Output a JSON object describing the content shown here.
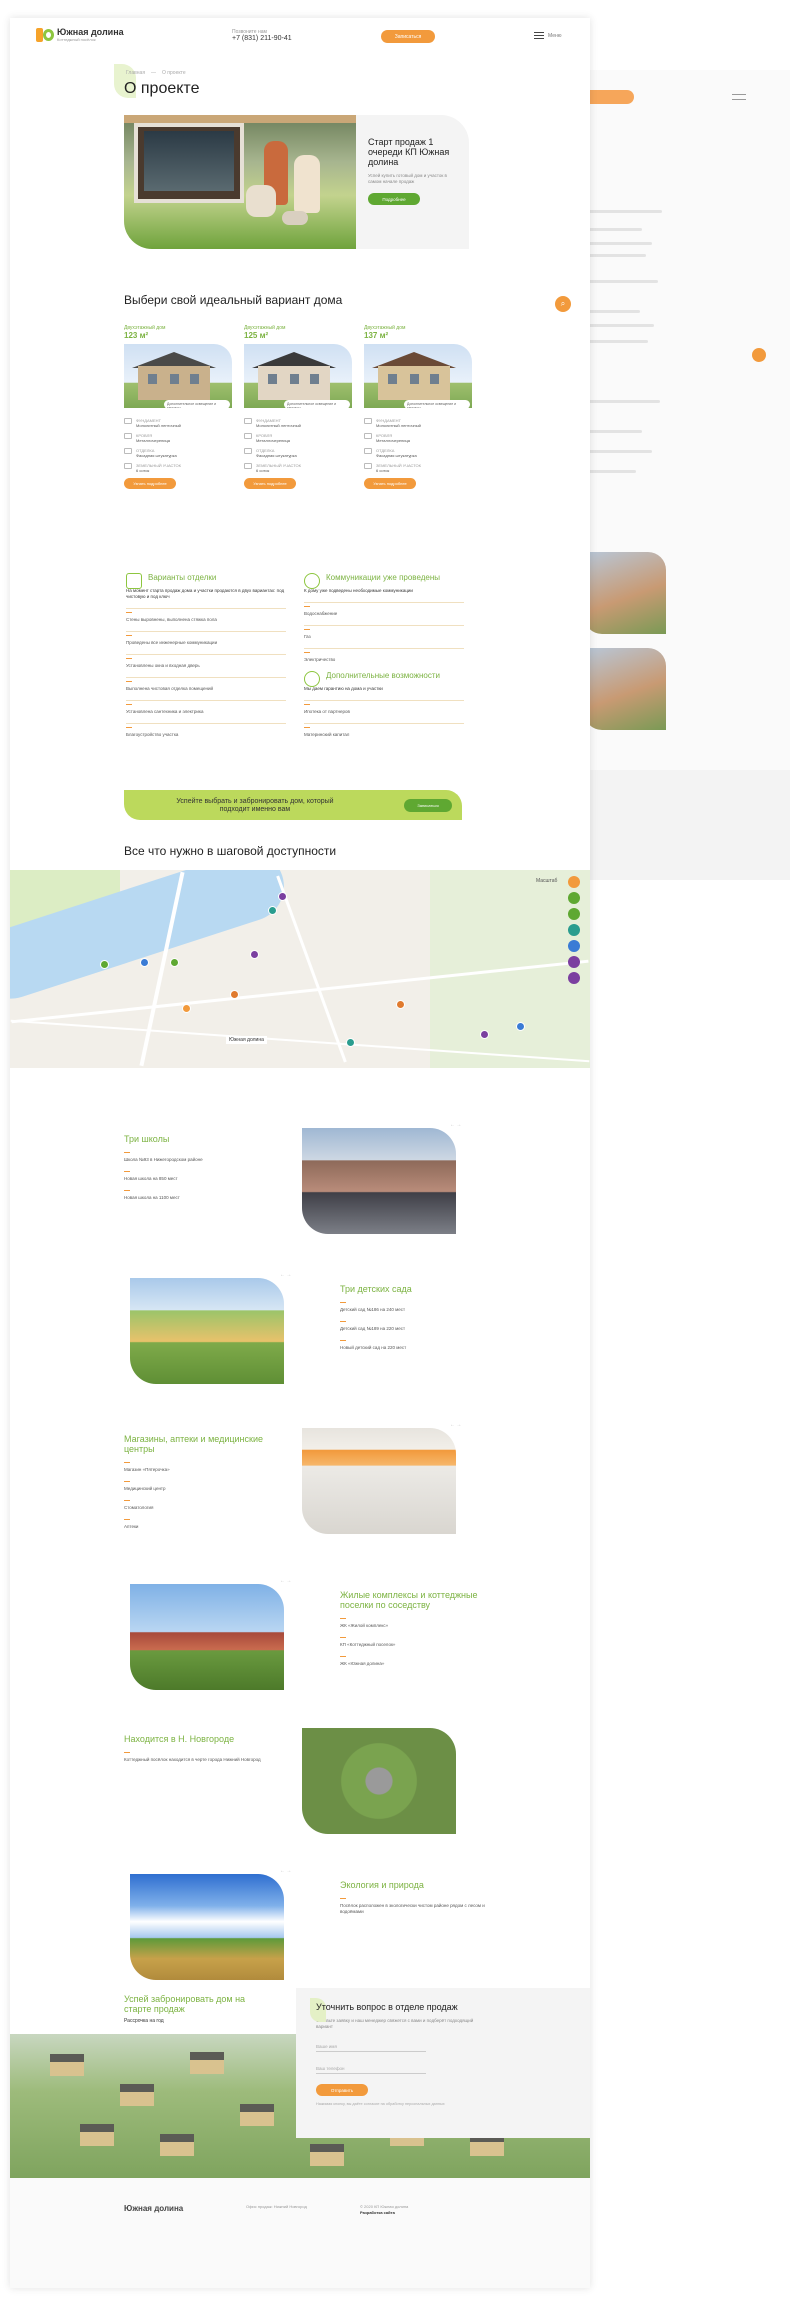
{
  "header": {
    "logo_text": "Южная долина",
    "logo_sub": "Коттеджный посёлок",
    "phone_caption": "Позвоните нам",
    "phone": "+7 (831) 211-90-41",
    "callback_label": "Записаться",
    "menu_label": "Меню"
  },
  "breadcrumbs": [
    "Главная",
    "О проекте"
  ],
  "page_title": "О проекте",
  "hero": {
    "title": "Старт продаж 1 очереди КП Южная долина",
    "text": "Успей купить готовый дом и участок в самом начале продаж",
    "button": "Подробнее"
  },
  "choose": {
    "title": "Выбери свой идеальный вариант дома",
    "houses": [
      {
        "name": "Двухэтажный дом",
        "area": "123 м²",
        "tag": "Дополнительное освещение и террасы",
        "specs": [
          [
            "ФУНДАМЕНТ",
            "Монолитный ленточный"
          ],
          [
            "КРОВЛЯ",
            "Металлочерепица"
          ],
          [
            "ОТДЕЛКА",
            "Фасадная штукатурка"
          ],
          [
            "ЗЕМЕЛЬНЫЙ УЧАСТОК",
            "6 соток"
          ]
        ],
        "button": "Узнать подробнее"
      },
      {
        "name": "Двухэтажный дом",
        "area": "125 м²",
        "tag": "Дополнительное освещение и террасы",
        "specs": [
          [
            "ФУНДАМЕНТ",
            "Монолитный ленточный"
          ],
          [
            "КРОВЛЯ",
            "Металлочерепица"
          ],
          [
            "ОТДЕЛКА",
            "Фасадная штукатурка"
          ],
          [
            "ЗЕМЕЛЬНЫЙ УЧАСТОК",
            "6 соток"
          ]
        ],
        "button": "Узнать подробнее"
      },
      {
        "name": "Двухэтажный дом",
        "area": "137 м²",
        "tag": "Дополнительное освещение и террасы",
        "specs": [
          [
            "ФУНДАМЕНТ",
            "Монолитный ленточный"
          ],
          [
            "КРОВЛЯ",
            "Металлочерепица"
          ],
          [
            "ОТДЕЛКА",
            "Фасадная штукатурка"
          ],
          [
            "ЗЕМЕЛЬНЫЙ УЧАСТОК",
            "6 соток"
          ]
        ],
        "button": "Узнать подробнее"
      }
    ]
  },
  "features": {
    "finish": {
      "title": "Варианты отделки",
      "lead": "На момент старта продаж дома и участки продаются в двух вариантах: под чистовую и под ключ",
      "items": [
        "Стены выровнены, выполнена стяжка пола",
        "Проведены все инженерные коммуникации",
        "Установлены окна и входная дверь",
        "Выполнена чистовая отделка помещений",
        "Установлена сантехника и электрика",
        "Благоустройство участка"
      ]
    },
    "utilities": {
      "title": "Коммуникации уже проведены",
      "lead": "К дому уже подведены необходимые коммуникации",
      "items": [
        "Водоснабжение",
        "Газ",
        "Электричество"
      ]
    },
    "extra": {
      "title": "Дополнительные возможности",
      "lead": "Мы даем гарантию на дома и участки",
      "items": [
        "Ипотека от партнеров",
        "Материнский капитал"
      ]
    }
  },
  "cta": {
    "text": "Успейте выбрать и забронировать дом, который подходит именно вам",
    "button": "Записаться"
  },
  "map_section": {
    "title": "Все что нужно в шаговой доступности",
    "label": "Южная долина",
    "zoom_label": "Масштаб"
  },
  "blocks": [
    {
      "title": "Три школы",
      "items": [
        "Школа №93 в Нижегородском районе",
        "Новая школа на 850 мест",
        "Новая школа на 1100 мест"
      ]
    },
    {
      "title": "Три детских сада",
      "items": [
        "Детский сад №186 на 240 мест",
        "Детский сад №189 на 220 мест",
        "Новый детский сад на 220 мест"
      ]
    },
    {
      "title": "Магазины, аптеки и медицинские центры",
      "items": [
        "Магазин «Пятерочка»",
        "Медицинский центр",
        "Стоматология",
        "Аптеки"
      ]
    },
    {
      "title": "Жилые комплексы и коттеджные поселки по соседству",
      "items": [
        "ЖК «Жилой комплекс»",
        "КП «Коттеджный поселок»",
        "ЖК «Южная долина»"
      ]
    },
    {
      "title": "Находится в Н. Новгороде",
      "items": [
        "Коттеджный посёлок находится в черте города Нижний Новгород"
      ]
    },
    {
      "title": "Экология и природа",
      "items": [
        "Посёлок расположен в экологически чистом районе рядом с лесом и водоёмами"
      ]
    }
  ],
  "bottom": {
    "title": "Успей забронировать дом на старте продаж",
    "subtitle": "Рассрочка на год",
    "form": {
      "title": "Уточнить вопрос в отделе продаж",
      "text": "Оставьте заявку и наш менеджер свяжется с вами и подберёт подходящий вариант",
      "name_placeholder": "Ваше имя",
      "phone_placeholder": "Ваш телефон",
      "submit": "Отправить",
      "agreement": "Нажимая кнопку, вы даёте согласие на обработку персональных данных"
    }
  },
  "footer": {
    "logo_text": "Южная долина",
    "col1": "Офис продаж: Нижний Новгород",
    "col2": "© 2020 КП Южная долина",
    "dev": "Разработка сайта"
  }
}
